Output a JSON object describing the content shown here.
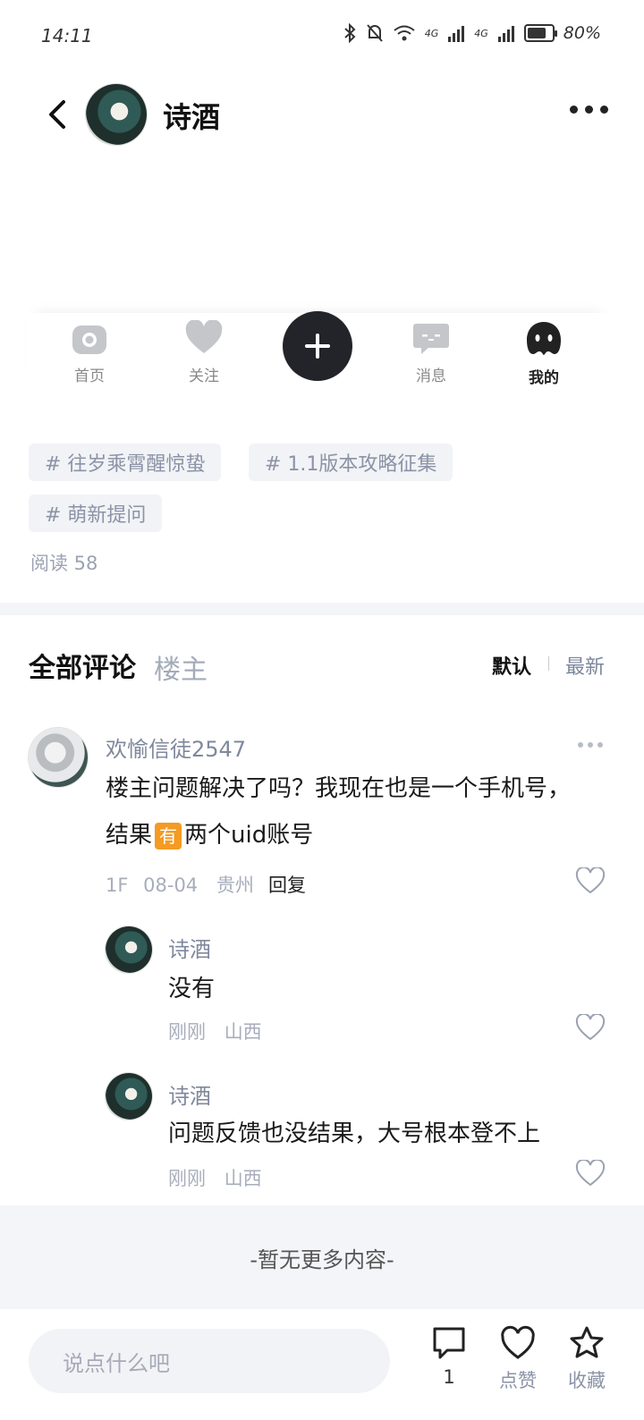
{
  "status": {
    "time": "14:11",
    "battery": "80%",
    "net1": "4G",
    "net2": "4G"
  },
  "header": {
    "name": "诗酒"
  },
  "tabbar": {
    "items": [
      {
        "label": "首页",
        "icon": "camera-icon"
      },
      {
        "label": "关注",
        "icon": "heart-icon"
      },
      {
        "label": "",
        "icon": "plus-icon"
      },
      {
        "label": "消息",
        "icon": "message-icon"
      },
      {
        "label": "我的",
        "icon": "profile-icon"
      }
    ]
  },
  "tags": [
    "# 往岁乘霄醒惊蛰",
    "# 1.1版本攻略征集",
    "# 萌新提问"
  ],
  "reads": "阅读 58",
  "comments": {
    "title": "全部评论",
    "op_filter": "楼主",
    "sort_default": "默认",
    "sort_newest": "最新",
    "main": {
      "user": "欢愉信徒2547",
      "text_line1": "楼主问题解决了吗？我现在也是一个手机号，",
      "text_line2_pre": "结果",
      "text_line2_emoji": "有",
      "text_line2_post": "两个uid账号",
      "floor": "1F",
      "date": "08-04",
      "location": "贵州",
      "reply_label": "回复"
    },
    "replies": [
      {
        "user": "诗酒",
        "text": "没有",
        "time": "刚刚",
        "location": "山西"
      },
      {
        "user": "诗酒",
        "text": "问题反馈也没结果，大号根本登不上",
        "time": "刚刚",
        "location": "山西"
      }
    ]
  },
  "footer_notice": "-暂无更多内容-",
  "bottombar": {
    "input_placeholder": "说点什么吧",
    "comment_count": "1",
    "like_label": "点赞",
    "fav_label": "收藏"
  }
}
